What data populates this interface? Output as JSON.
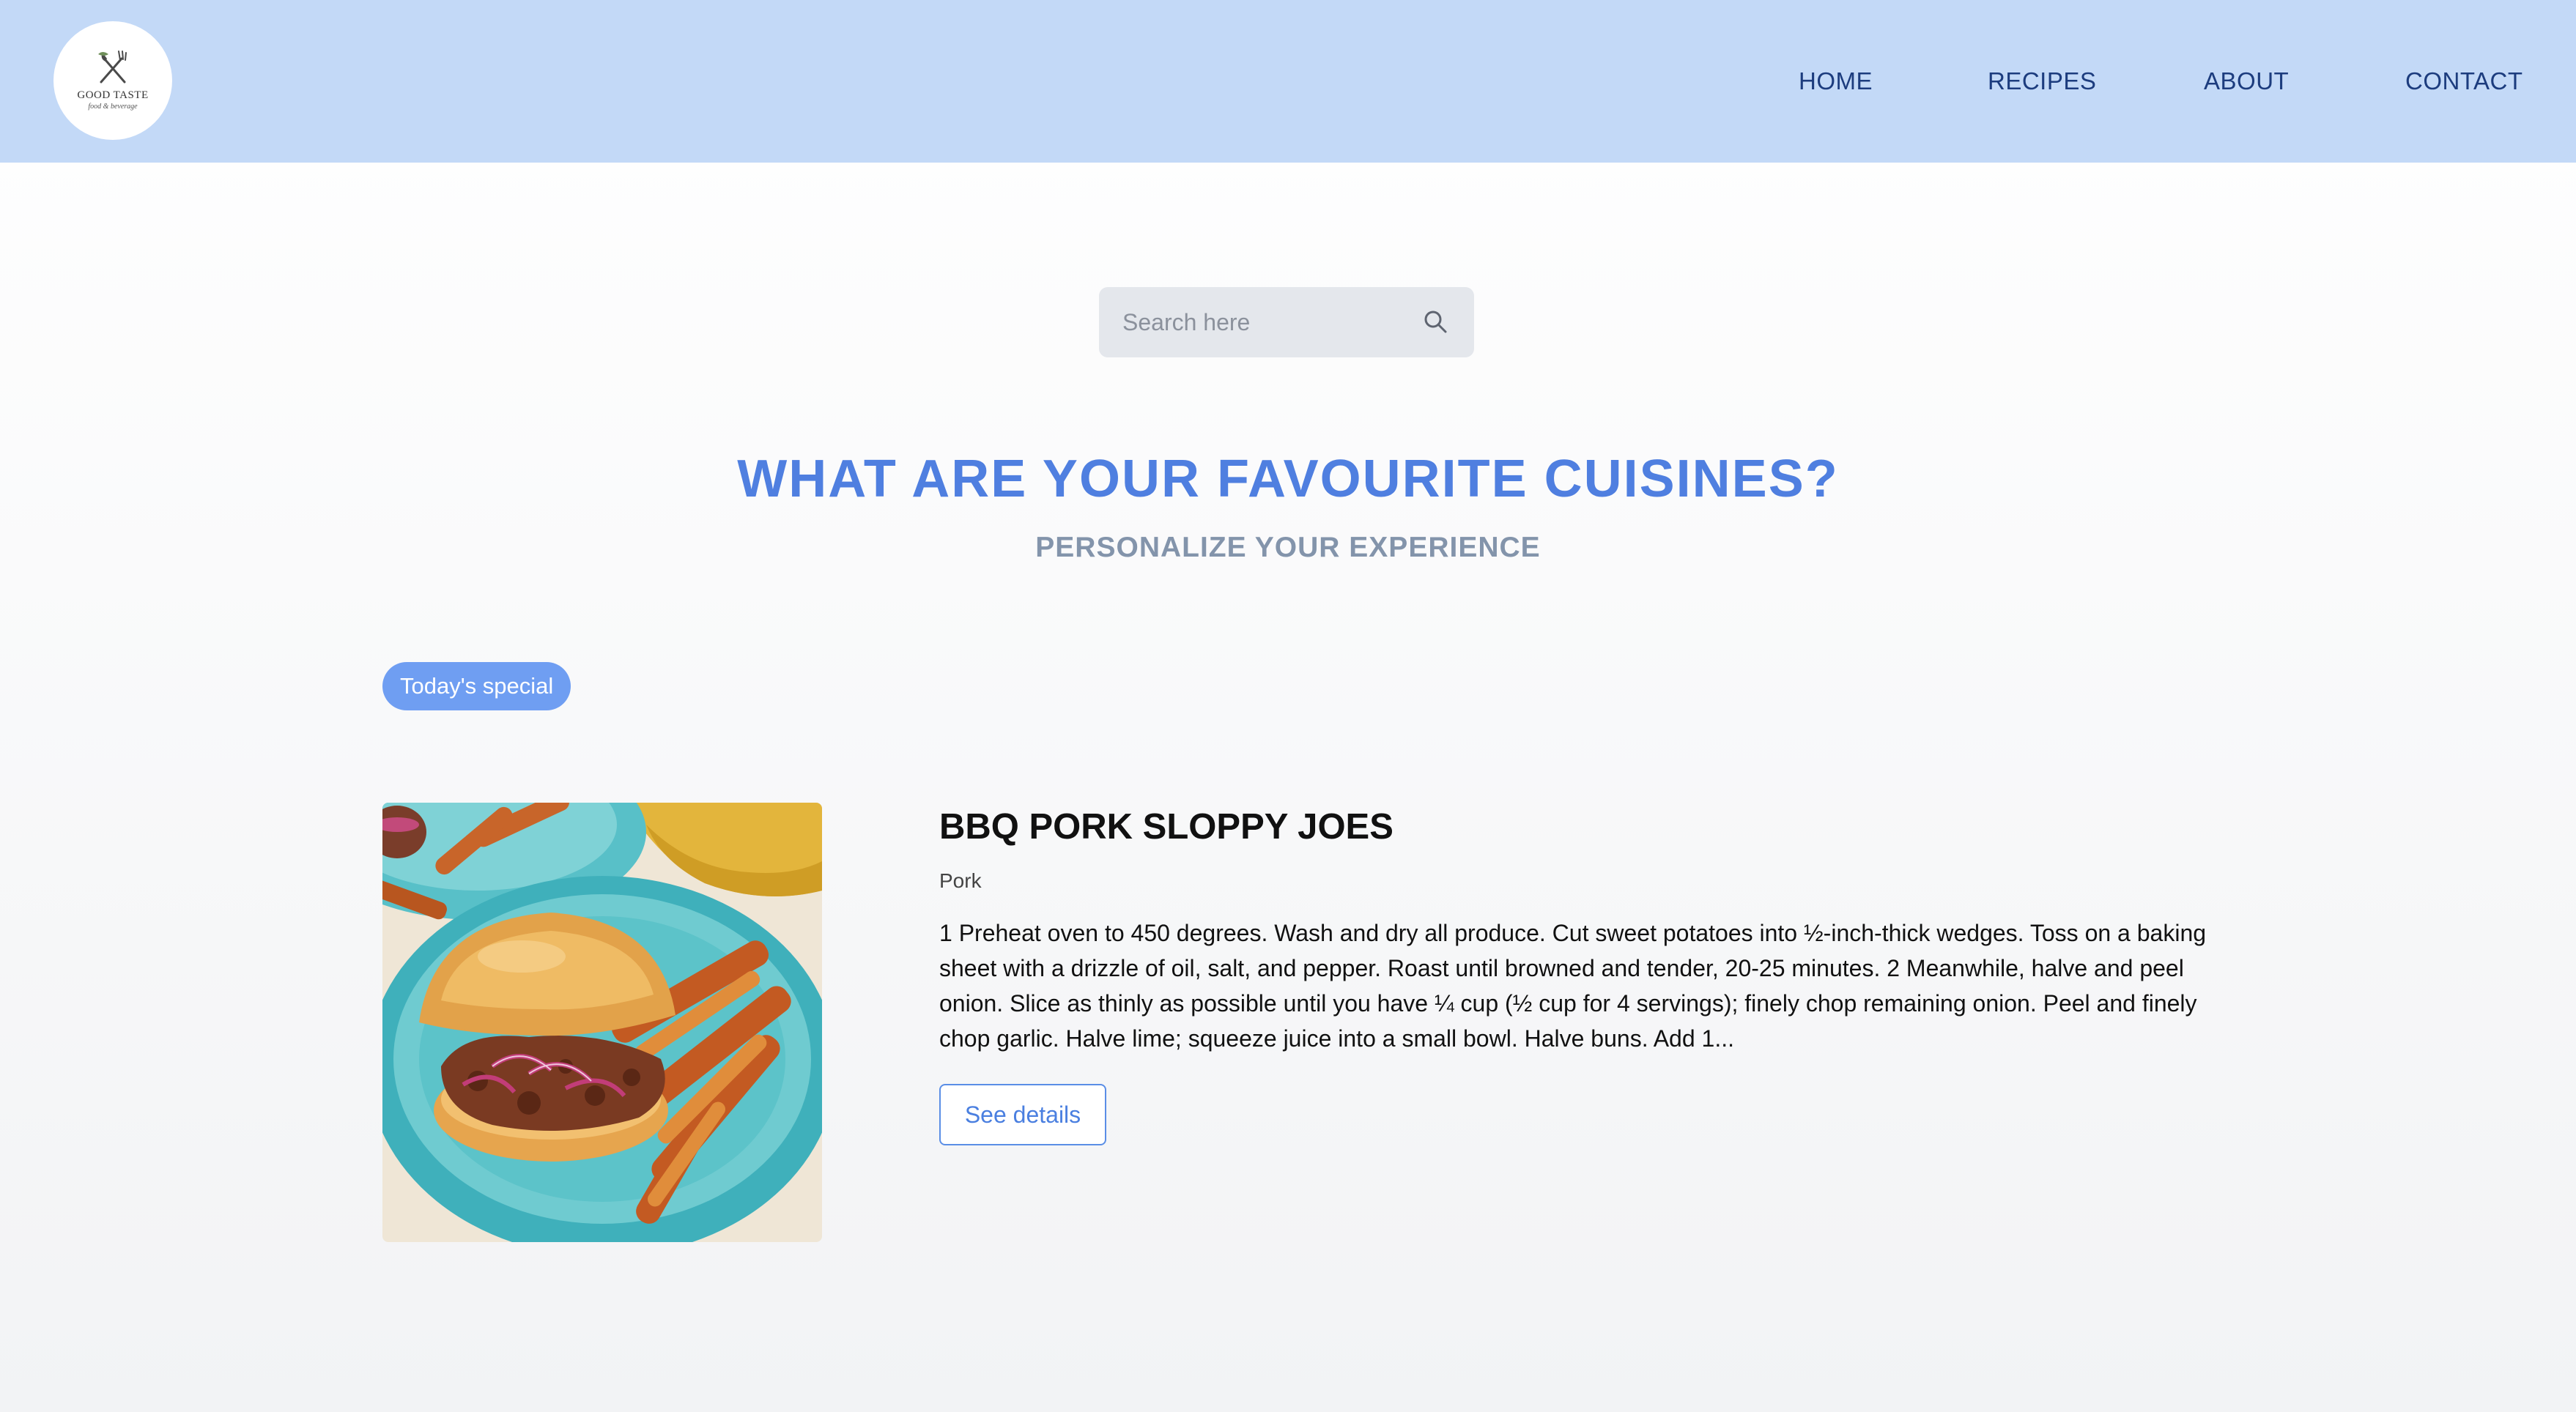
{
  "header": {
    "logo": {
      "name": "GOOD TASTE",
      "tagline": "food & beverage"
    },
    "nav": [
      {
        "label": "HOME"
      },
      {
        "label": "RECIPES"
      },
      {
        "label": "ABOUT"
      },
      {
        "label": "CONTACT"
      }
    ]
  },
  "search": {
    "placeholder": "Search here",
    "value": ""
  },
  "hero": {
    "title": "WHAT ARE YOUR FAVOURITE CUISINES?",
    "subtitle": "PERSONALIZE YOUR EXPERIENCE"
  },
  "special": {
    "badge": "Today's special",
    "recipe": {
      "title": "BBQ PORK SLOPPY JOES",
      "category": "Pork",
      "description": "1 Preheat oven to 450 degrees. Wash and dry all produce. Cut sweet potatoes into ½-inch-thick wedges. Toss on a baking sheet with a drizzle of oil, salt, and pepper. Roast until browned and tender, 20-25 minutes. 2 Meanwhile, halve and peel onion. Slice as thinly as possible until you have ¼ cup (½ cup for 4 servings); finely chop remaining onion. Peel and finely chop garlic. Halve lime; squeeze juice into a small bowl. Halve buns. Add 1...",
      "button_label": "See details"
    }
  },
  "colors": {
    "header_bg": "#c3d9f7",
    "nav_text": "#1c3c7e",
    "accent": "#4f7fe0",
    "badge_bg": "#6f9ef2"
  }
}
